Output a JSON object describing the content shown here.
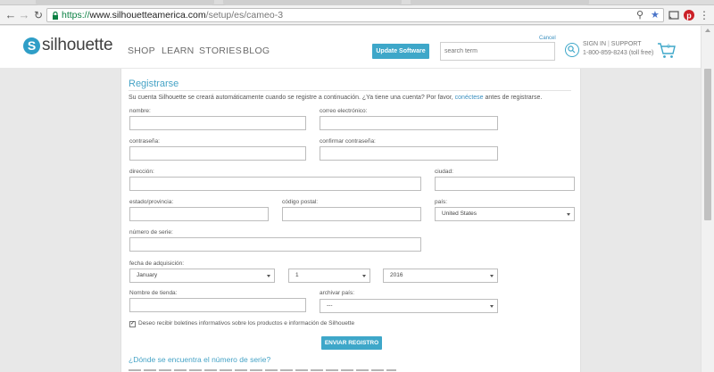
{
  "browser": {
    "url_scheme": "https://",
    "url_host": "www.silhouetteamerica.com",
    "url_path": "/setup/es/cameo-3",
    "icons": [
      "back-icon",
      "forward-icon",
      "reload-icon",
      "lock-icon",
      "zoom-icon",
      "bookmark-star-icon",
      "cast-icon",
      "pinterest-icon",
      "menu-icon"
    ]
  },
  "header": {
    "logo_letter": "S",
    "logo_text": "silhouette",
    "nav": [
      "SHOP",
      "LEARN",
      "STORIES",
      "BLOG"
    ],
    "update_button": "Update Software",
    "cancel": "Cancel",
    "search_placeholder": "search term",
    "sign_in": "SIGN IN",
    "support": "SUPPORT",
    "phone": "1-800-859-8243 (toll free)",
    "cart_count": "0"
  },
  "form": {
    "title": "Registrarse",
    "intro_before": "Su cuenta Silhouette se creará automáticamente cuando se registre a continuación. ¿Ya tiene una cuenta? Por favor, ",
    "intro_link": "conéctese",
    "intro_after": " antes de registrarse.",
    "labels": {
      "name": "nombre:",
      "email": "correo electrónico:",
      "password": "contraseña:",
      "confirm_password": "confirmar contraseña:",
      "address": "dirección:",
      "city": "ciudad:",
      "state": "estado/provincia:",
      "postal": "código postal:",
      "country": "país:",
      "serial": "número de serie:",
      "purchase_date": "fecha de adquisición:",
      "store": "Nombre de tienda:",
      "archive_country": "archivar país:"
    },
    "country_value": "United States",
    "month_value": "January",
    "day_value": "1",
    "year_value": "2016",
    "archive_country_value": "---",
    "newsletter_checked": true,
    "newsletter_label": "Deseo recibir boletines informativos sobre los productos e información de Silhouette",
    "submit": "ENVIAR REGISTRO",
    "where_serial": "¿Dónde se encuentra el número de serie?"
  },
  "colors": {
    "accent": "#3ea7c9",
    "link": "#3a8fbf"
  }
}
